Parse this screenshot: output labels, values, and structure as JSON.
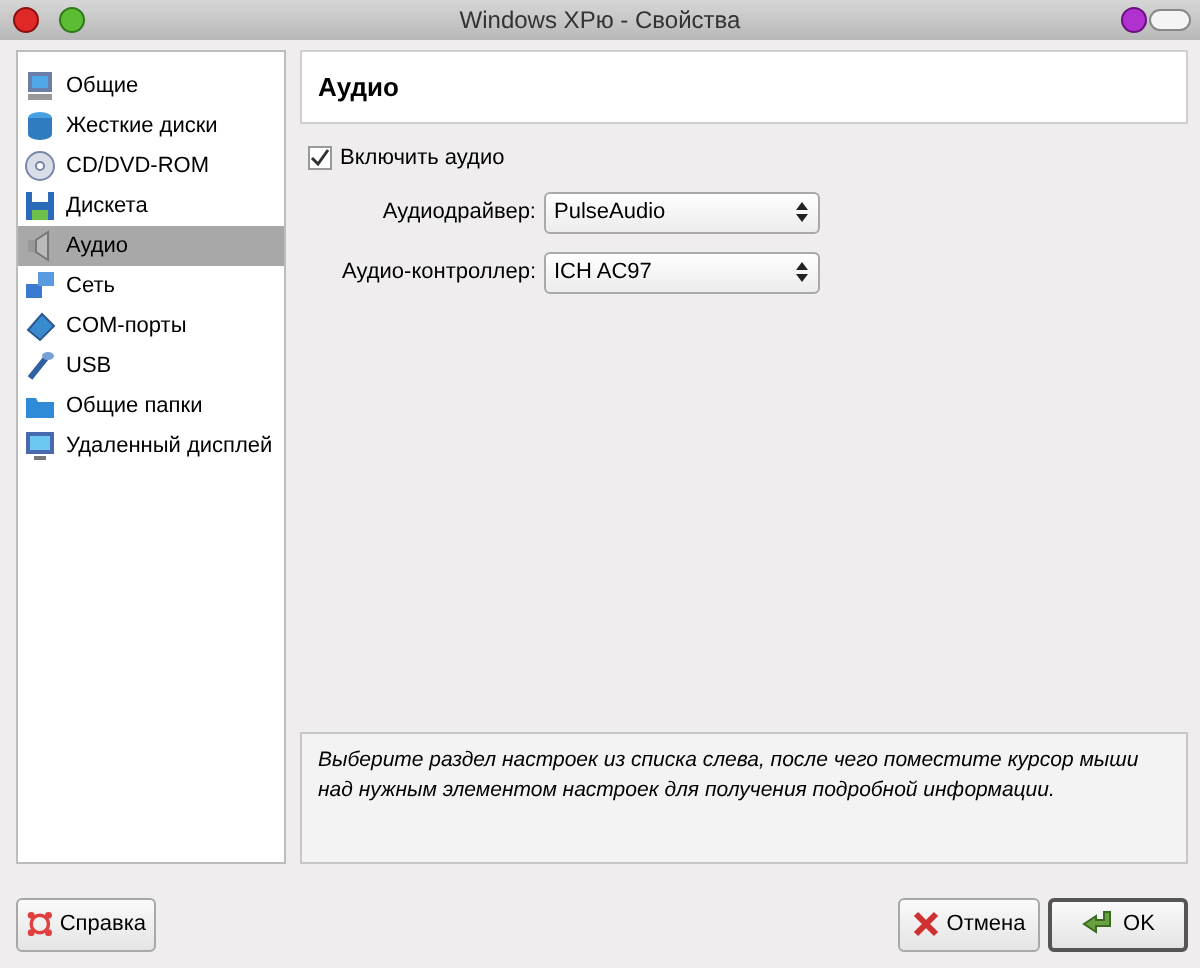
{
  "window": {
    "title": "Windows XPю - Свойства"
  },
  "sidebar": {
    "items": [
      {
        "label": "Общие",
        "kind": "monitor",
        "selected": false
      },
      {
        "label": "Жесткие диски",
        "kind": "disks",
        "selected": false
      },
      {
        "label": "CD/DVD-ROM",
        "kind": "cd",
        "selected": false
      },
      {
        "label": "Дискета",
        "kind": "floppy",
        "selected": false
      },
      {
        "label": "Аудио",
        "kind": "speaker",
        "selected": true
      },
      {
        "label": "Сеть",
        "kind": "network",
        "selected": false
      },
      {
        "label": "COM-порты",
        "kind": "port",
        "selected": false
      },
      {
        "label": "USB",
        "kind": "usb",
        "selected": false
      },
      {
        "label": "Общие папки",
        "kind": "folder",
        "selected": false
      },
      {
        "label": "Удаленный дисплей",
        "kind": "display",
        "selected": false
      }
    ]
  },
  "page": {
    "title": "Аудио",
    "enable_checkbox": {
      "label": "Включить аудио",
      "checked": true
    },
    "fields": [
      {
        "label": "Аудиодрайвер:",
        "value": "PulseAudio"
      },
      {
        "label": "Аудио-контроллер:",
        "value": "ICH AC97"
      }
    ]
  },
  "info": "Выберите раздел настроек из списка слева, после чего поместите курсор мыши над нужным элементом настроек для получения подробной информации.",
  "buttons": [
    {
      "label": "Справка",
      "kind": "help"
    },
    {
      "label": "Отмена",
      "kind": "cancel"
    },
    {
      "label": "OK",
      "kind": "ok"
    }
  ]
}
